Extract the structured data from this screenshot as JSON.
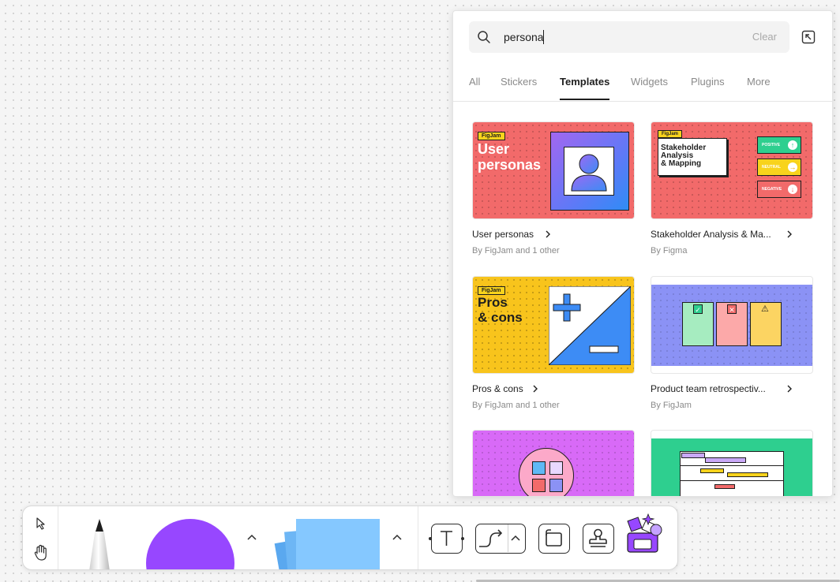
{
  "search": {
    "value": "persona",
    "clear_label": "Clear"
  },
  "tabs": [
    {
      "label": "All",
      "active": false
    },
    {
      "label": "Stickers",
      "active": false
    },
    {
      "label": "Templates",
      "active": true
    },
    {
      "label": "Widgets",
      "active": false
    },
    {
      "label": "Plugins",
      "active": false
    },
    {
      "label": "More",
      "active": false
    }
  ],
  "results": [
    {
      "title": "User personas",
      "author": "By FigJam and 1 other",
      "thumb": {
        "badge": "FigJam",
        "heading_line1": "User",
        "heading_line2": "personas",
        "bg": "#f26a6a"
      }
    },
    {
      "title": "Stakeholder Analysis & Ma...",
      "author": "By Figma",
      "thumb": {
        "badge": "FigJam",
        "heading_line1": "Stakeholder",
        "heading_line2": "Analysis",
        "heading_line3": "& Mapping",
        "chips": [
          "POSITIVE",
          "NEUTRAL",
          "NEGATIVE"
        ],
        "bg": "#f26a6a"
      }
    },
    {
      "title": "Pros & cons",
      "author": "By FigJam and 1 other",
      "thumb": {
        "badge": "FigJam",
        "heading_line1": "Pros",
        "heading_line2": "& cons",
        "bg": "#f8c41c"
      }
    },
    {
      "title": "Product team retrospectiv...",
      "author": "By FigJam",
      "thumb": {
        "bg": "#8b92f5"
      }
    },
    {
      "thumb": {
        "bg": "#d86af7"
      }
    },
    {
      "thumb": {
        "bg": "#2ecf8f"
      }
    }
  ],
  "toolbar": {
    "tools": [
      "select-tool",
      "hand-tool",
      "marker-tool",
      "shape-tool",
      "sticky-note-tool",
      "text-tool",
      "connector-tool",
      "section-tool",
      "stamp-tool",
      "more-tools"
    ]
  },
  "colors": {
    "accent_purple": "#9747ff",
    "sticky_blue": "#85c8ff",
    "panel_bg": "#ffffff"
  }
}
